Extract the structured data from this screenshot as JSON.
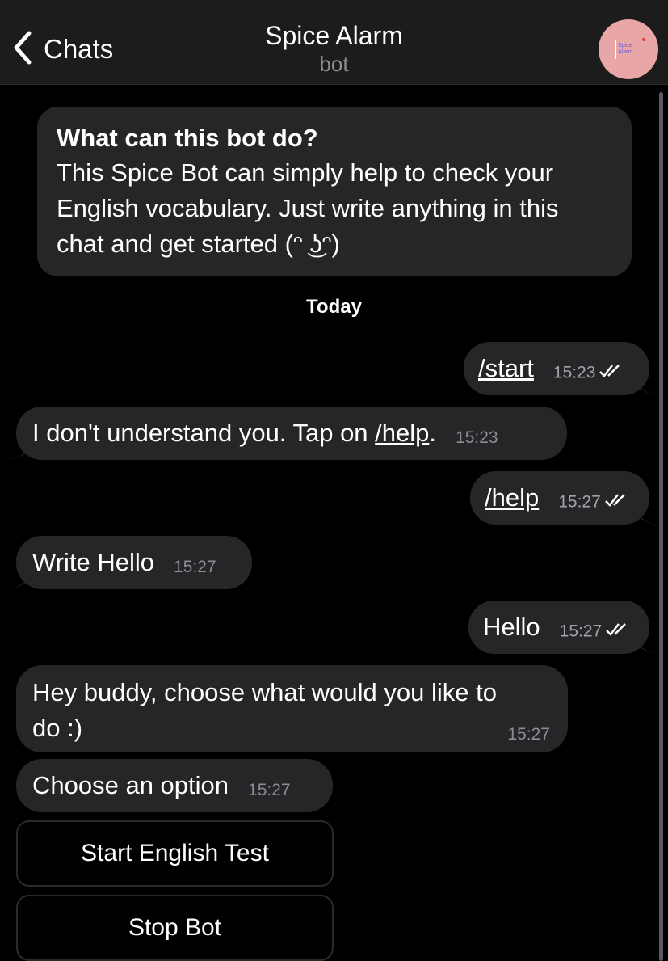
{
  "header": {
    "back_label": "Chats",
    "title": "Spice Alarm",
    "subtitle": "bot",
    "avatar_text": "Spice Alarm",
    "avatar_color": "#e8a6a6"
  },
  "intro": {
    "title": "What can this bot do?",
    "body_line1": "This Spice Bot can simply help to check your",
    "body_line2": "English vocabulary. Just write anything in this",
    "body_line3": "chat and get started (ᵔ ͜ʖᵔ)"
  },
  "date_separator": "Today",
  "messages": [
    {
      "direction": "out",
      "text": "/start",
      "time": "15:23",
      "read": true
    },
    {
      "direction": "in",
      "text_prefix": "I don't understand you. Tap on ",
      "command": "/help",
      "text_suffix": ".",
      "time": "15:23"
    },
    {
      "direction": "out",
      "text": "/help",
      "time": "15:27",
      "read": true
    },
    {
      "direction": "in",
      "text": "Write Hello",
      "time": "15:27"
    },
    {
      "direction": "out",
      "text": "Hello",
      "time": "15:27",
      "read": true
    },
    {
      "direction": "in",
      "line1": "Hey buddy, choose what would you like to",
      "line2": "do :)",
      "time": "15:27"
    },
    {
      "direction": "in",
      "text": "Choose an option",
      "time": "15:27"
    }
  ],
  "keyboard": [
    {
      "label": "Start English Test"
    },
    {
      "label": "Stop Bot"
    }
  ],
  "colors": {
    "background": "#000000",
    "header": "#1c1c1d",
    "bubble": "#262628",
    "secondary_text": "#8d8d92"
  }
}
